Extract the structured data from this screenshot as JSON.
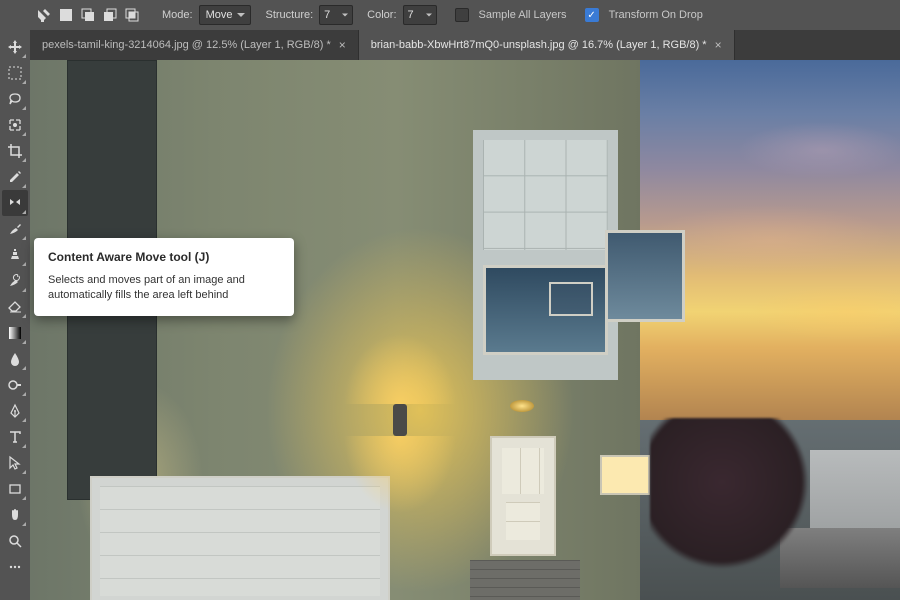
{
  "options_bar": {
    "mode_label": "Mode:",
    "mode_value": "Move",
    "structure_label": "Structure:",
    "structure_value": "7",
    "color_label": "Color:",
    "color_value": "7",
    "sample_all_layers_label": "Sample All Layers",
    "sample_all_layers_checked": false,
    "transform_on_drop_label": "Transform On Drop",
    "transform_on_drop_checked": true
  },
  "tabs": [
    {
      "label": "pexels-tamil-king-3214064.jpg @ 12.5% (Layer 1, RGB/8) *",
      "active": false
    },
    {
      "label": "brian-babb-XbwHrt87mQ0-unsplash.jpg @ 16.7% (Layer 1, RGB/8) *",
      "active": true
    }
  ],
  "tooltip": {
    "title": "Content Aware Move tool (J)",
    "body": "Selects and moves part of an image and automatically fills the area left behind"
  },
  "tools": [
    "move-tool",
    "marquee-tool",
    "lasso-tool",
    "quick-selection-tool",
    "crop-tool",
    "eyedropper-tool",
    "content-aware-move-tool",
    "brush-tool",
    "clone-stamp-tool",
    "history-brush-tool",
    "eraser-tool",
    "gradient-tool",
    "blur-tool",
    "dodge-tool",
    "pen-tool",
    "type-tool",
    "path-selection-tool",
    "rectangle-tool",
    "hand-tool",
    "zoom-tool",
    "more-tool"
  ]
}
